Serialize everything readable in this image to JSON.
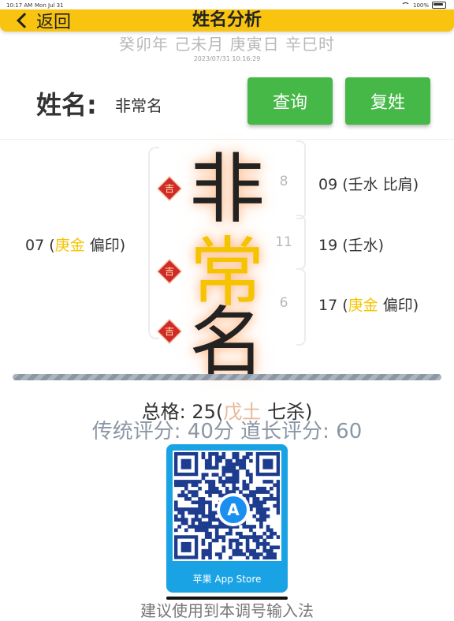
{
  "status_bar": {
    "time": "10:17 AM",
    "date": "Mon Jul 31",
    "battery": "100%"
  },
  "nav": {
    "back_label": "返回",
    "title": "姓名分析"
  },
  "ganzhi": "癸卯年 己未月 庚寅日 辛巳时",
  "datetime": "2023/07/31 10:16:29",
  "name_row": {
    "label": "姓名:",
    "value": "非常名"
  },
  "buttons": {
    "query": "查询",
    "surname": "复姓"
  },
  "characters": [
    {
      "char": "非",
      "strokes": "8",
      "badge": "吉"
    },
    {
      "char": "常",
      "strokes": "11",
      "badge": "吉"
    },
    {
      "char": "名",
      "strokes": "6",
      "badge": "吉"
    }
  ],
  "right_ge": [
    {
      "num": "09",
      "open": "(",
      "elem": "",
      "close_text": "壬水 比肩)"
    },
    {
      "num": "19",
      "open": "(",
      "elem": "",
      "close_text": "壬水)"
    },
    {
      "num": "17",
      "open": "(",
      "elem": "庚金",
      "close_text": " 偏印)"
    }
  ],
  "left_ge": {
    "num": "07",
    "open": "(",
    "elem": "庚金",
    "close_text": " 偏印)"
  },
  "zongge": {
    "prefix": "总格: 25(",
    "elem": "戊土",
    "suffix": " 七杀)"
  },
  "score": "传统评分: 40分 道长评分: 60",
  "qr": {
    "label": "苹果 App Store",
    "icon": "app-store-icon"
  },
  "bottom_text": "建议使用到本调号输入法",
  "colors": {
    "nav": "#f9c410",
    "button": "#46b847",
    "accent_yellow": "#f5c400",
    "badge_red": "#d12a2a",
    "qr_card": "#1aa3e4"
  }
}
